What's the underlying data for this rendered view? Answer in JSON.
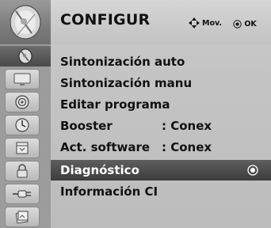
{
  "header": {
    "title": "CONFIGUR",
    "hint_move": "Mov.",
    "hint_ok": "OK",
    "move_icon": "four-way-arrows-icon",
    "ok_icon": "ok-button-icon"
  },
  "sidebar": {
    "items": [
      {
        "icon": "satellite-dish-icon"
      },
      {
        "icon": "tv-screen-icon"
      },
      {
        "icon": "speaker-icon"
      },
      {
        "icon": "clock-icon"
      },
      {
        "icon": "calendar-icon"
      },
      {
        "icon": "padlock-icon"
      },
      {
        "icon": "input-plug-icon"
      },
      {
        "icon": "usb-photo-icon"
      }
    ]
  },
  "menu": {
    "items": [
      {
        "label": "Sintonización auto",
        "value": ""
      },
      {
        "label": "Sintonización manu",
        "value": ""
      },
      {
        "label": "Editar programa",
        "value": ""
      },
      {
        "label": "Booster",
        "value": ": Conex"
      },
      {
        "label": "Act. software",
        "value": ": Conex"
      },
      {
        "label": "Diagnóstico",
        "value": ""
      },
      {
        "label": "Información CI",
        "value": ""
      }
    ]
  },
  "colors": {
    "highlight": "#4a4a4a",
    "background": "#c2c2c2",
    "text": "#111111",
    "highlight_text": "#ffffff"
  }
}
